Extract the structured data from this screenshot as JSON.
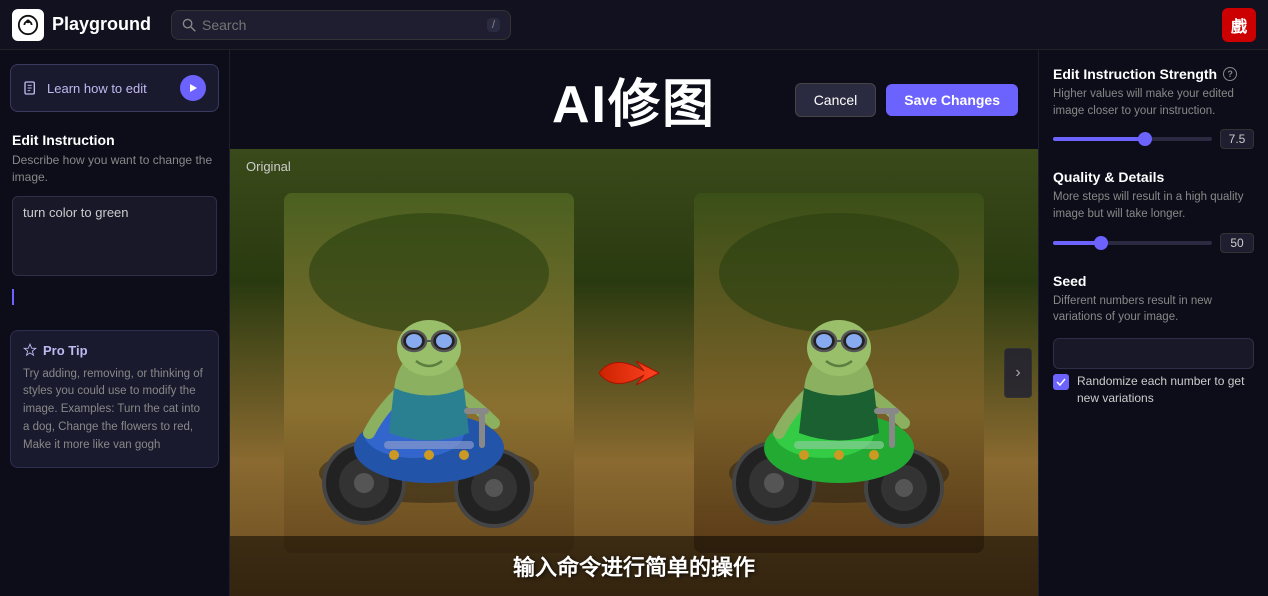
{
  "topbar": {
    "logo_icon": "◑",
    "title": "Playground",
    "search_placeholder": "Search",
    "search_shortcut": "/",
    "avatar_text": "戲"
  },
  "sidebar_left": {
    "learn_btn_label": "Learn how to edit",
    "learn_btn_icon": "▶",
    "edit_instruction_title": "Edit Instruction",
    "edit_instruction_desc": "Describe how you want to change the image.",
    "edit_instruction_value": "turn color to green",
    "pro_tip_title": "Pro Tip",
    "pro_tip_text": "Try adding, removing, or thinking of styles you could use to modify the image. Examples: Turn the cat into a dog, Change the flowers to red, Make it more like van gogh"
  },
  "center": {
    "title": "AI修图",
    "cancel_label": "Cancel",
    "save_label": "Save Changes",
    "original_label": "Original",
    "subtitle": "输入命令进行简单的操作",
    "arrow_symbol": "➜"
  },
  "right_sidebar": {
    "strength_title": "Edit Instruction Strength",
    "strength_desc": "Higher values will make your edited image closer to your instruction.",
    "strength_value": "7.5",
    "strength_pct": 58,
    "quality_title": "Quality & Details",
    "quality_desc": "More steps will result in a high quality image but will take longer.",
    "quality_value": "50",
    "quality_pct": 30,
    "seed_title": "Seed",
    "seed_desc": "Different numbers result in new variations of your image.",
    "seed_value": "",
    "seed_placeholder": "",
    "randomize_label": "Randomize each number to get new variations"
  }
}
